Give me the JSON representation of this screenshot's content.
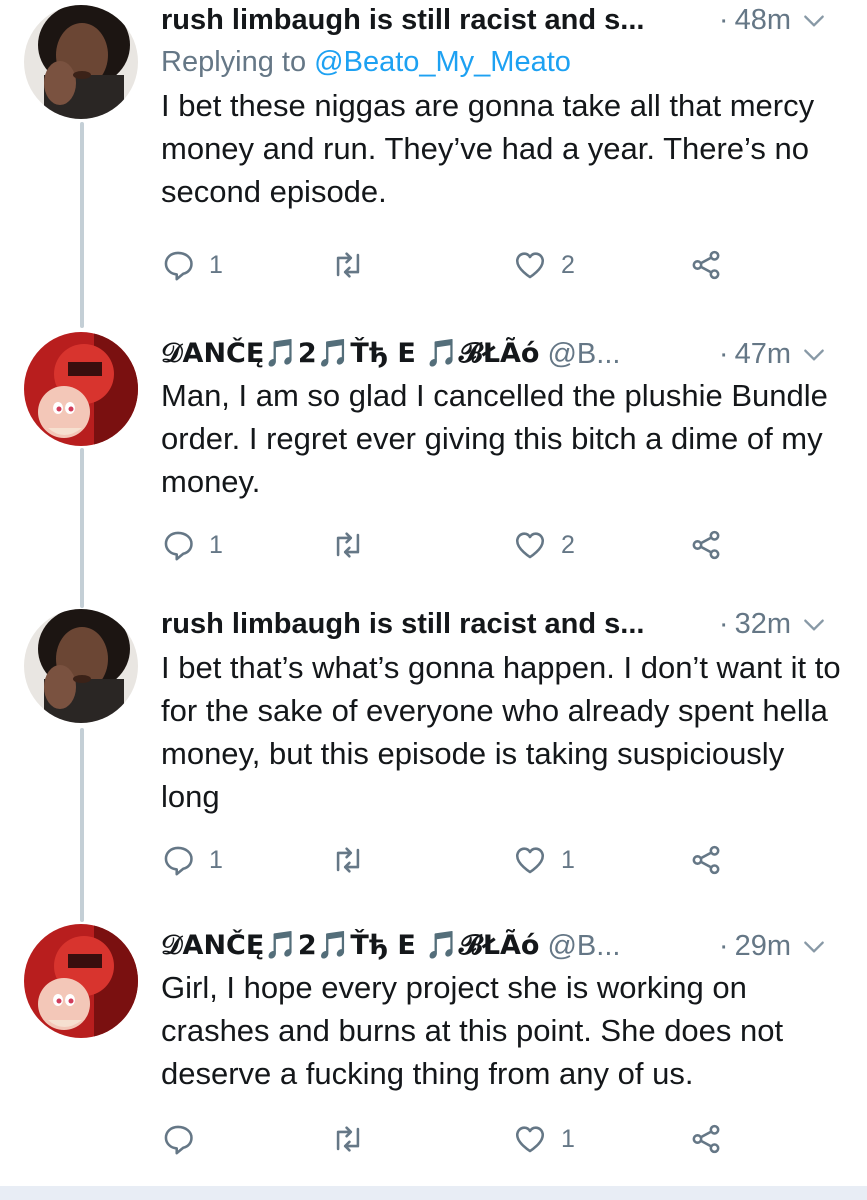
{
  "reply_count_label": "",
  "tweets": [
    {
      "name": "rush limbaugh is still racist and s...",
      "handle": "",
      "time": "48m",
      "replying_prefix": "Replying to ",
      "replying_user": "@Beato_My_Meato",
      "text": "I bet these niggas are gonna take all that mercy money and run. They’ve had a year. There’s no second episode.",
      "replies": "1",
      "retweets": "",
      "likes": "2"
    },
    {
      "name": "𝒟ANČĘ🎵2🎵Ťђ E 🎵𝓑ŁÃό",
      "handle": "@B...",
      "time": "47m",
      "text": "Man, I am so glad I cancelled the plushie Bundle order. I regret ever giving this bitch a dime of my money.",
      "replies": "1",
      "retweets": "",
      "likes": "2"
    },
    {
      "name": "rush limbaugh is still racist and s...",
      "handle": "",
      "time": "32m",
      "text": "I bet that’s what’s gonna happen. I don’t want it to for the sake of everyone who already spent hella money, but this episode is taking suspiciously long",
      "replies": "1",
      "retweets": "",
      "likes": "1"
    },
    {
      "name": "𝒟ANČĘ🎵2🎵Ťђ E 🎵𝓑ŁÃό",
      "handle": "@B...",
      "time": "29m",
      "text": "Girl, I hope every project she is working on crashes and burns at this point. She does not deserve a fucking thing from any of us.",
      "replies": "",
      "retweets": "",
      "likes": "1"
    }
  ],
  "icons": {
    "reply": "speech-bubble-icon",
    "retweet": "retweet-arrows-icon",
    "like": "heart-outline-icon",
    "share": "share-nodes-icon",
    "more": "chevron-down-icon"
  },
  "colors": {
    "link": "#1da1f2",
    "secondary_text": "#657786",
    "thread_line": "#c4cfd6"
  }
}
